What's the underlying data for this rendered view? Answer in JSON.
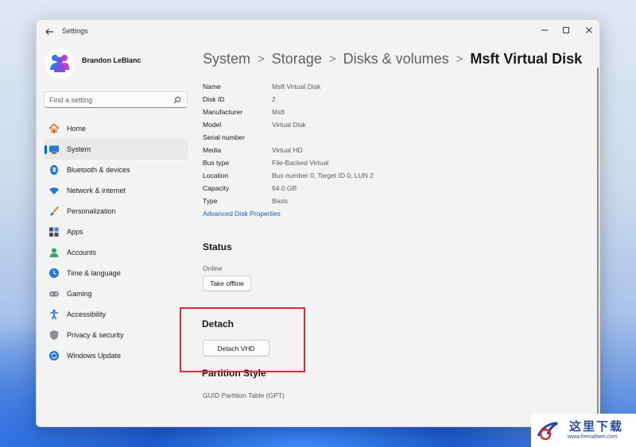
{
  "window": {
    "title": "Settings",
    "controls": {
      "minimize_icon": "minimize-icon",
      "maximize_icon": "maximize-icon",
      "close_icon": "close-icon"
    }
  },
  "profile": {
    "name": "Brandon LeBlanc"
  },
  "search": {
    "placeholder": "Find a setting"
  },
  "sidebar": {
    "items": [
      {
        "label": "Home",
        "icon": "home-icon"
      },
      {
        "label": "System",
        "icon": "system-icon",
        "active": true
      },
      {
        "label": "Bluetooth & devices",
        "icon": "bluetooth-icon"
      },
      {
        "label": "Network & internet",
        "icon": "network-icon"
      },
      {
        "label": "Personalization",
        "icon": "brush-icon"
      },
      {
        "label": "Apps",
        "icon": "apps-icon"
      },
      {
        "label": "Accounts",
        "icon": "accounts-icon"
      },
      {
        "label": "Time & language",
        "icon": "time-language-icon"
      },
      {
        "label": "Gaming",
        "icon": "gaming-icon"
      },
      {
        "label": "Accessibility",
        "icon": "accessibility-icon"
      },
      {
        "label": "Privacy & security",
        "icon": "shield-icon"
      },
      {
        "label": "Windows Update",
        "icon": "update-icon"
      }
    ]
  },
  "breadcrumb": {
    "items": [
      "System",
      "Storage",
      "Disks & volumes",
      "Msft Virtual Disk"
    ],
    "separator": ">"
  },
  "properties": [
    {
      "label": "Name",
      "value": "Msft Virtual Disk"
    },
    {
      "label": "Disk ID",
      "value": "2"
    },
    {
      "label": "Manufacturer",
      "value": "Msft"
    },
    {
      "label": "Model",
      "value": "Virtual Disk"
    },
    {
      "label": "Serial number",
      "value": ""
    },
    {
      "label": "Media",
      "value": "Virtual HD"
    },
    {
      "label": "Bus type",
      "value": "File-Backed Virtual"
    },
    {
      "label": "Location",
      "value": "Bus number 0, Target ID 0, LUN 2"
    },
    {
      "label": "Capacity",
      "value": "64.0 GB"
    },
    {
      "label": "Type",
      "value": "Basic"
    }
  ],
  "advanced_link": "Advanced Disk Properties",
  "status": {
    "title": "Status",
    "value": "Online",
    "button": "Take offline"
  },
  "detach": {
    "title": "Detach",
    "button": "Detach VHD"
  },
  "partition": {
    "title": "Partition Style",
    "value": "GUID Partition Table (GPT)"
  },
  "watermark": {
    "text": "这里下载",
    "url": "www.herodown.com"
  },
  "colors": {
    "accent": "#0067c0",
    "highlight": "#e0282e",
    "link": "#1a5fb4"
  }
}
